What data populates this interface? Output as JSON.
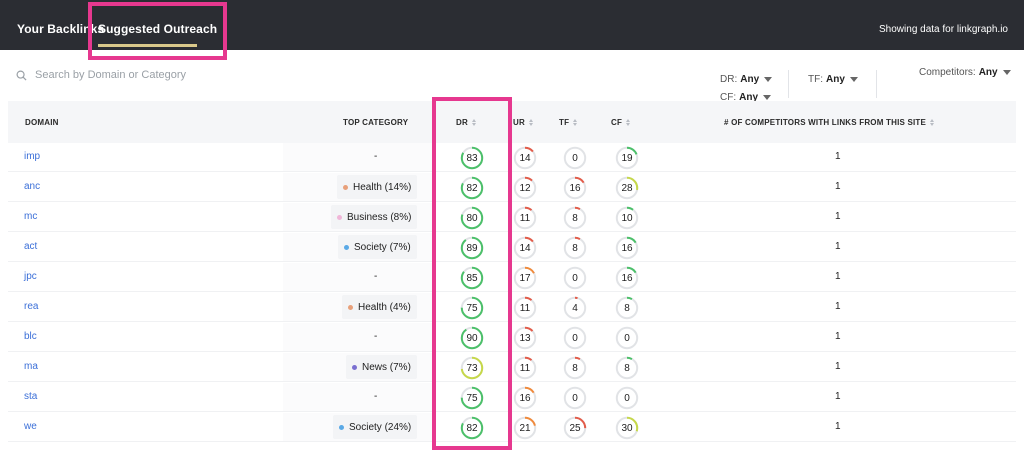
{
  "topbar": {
    "tabs": [
      {
        "label": "Your Backlinks"
      },
      {
        "label": "Suggested Outreach"
      }
    ],
    "status_text": "Showing data for linkgraph.io"
  },
  "search": {
    "placeholder": "Search by Domain or Category"
  },
  "filters": {
    "dr_label": "DR:",
    "dr_value": "Any",
    "cf_label": "CF:",
    "cf_value": "Any",
    "tf_label": "TF:",
    "tf_value": "Any",
    "competitors_label": "Competitors:",
    "competitors_value": "Any"
  },
  "table": {
    "headers": {
      "domain": "DOMAIN",
      "category": "TOP CATEGORY",
      "dr": "DR",
      "ur": "UR",
      "tf": "TF",
      "cf": "CF",
      "competitors": "# OF COMPETITORS WITH LINKS FROM THIS SITE"
    },
    "rows": [
      {
        "domain": "imp",
        "category": "-",
        "cat_color": "",
        "dr": 83,
        "ur": 14,
        "tf": 0,
        "cf": 19,
        "competitors": "1"
      },
      {
        "domain": "anc",
        "category": "Health (14%)",
        "cat_color": "#e8a07a",
        "dr": 82,
        "ur": 12,
        "tf": 16,
        "cf": 28,
        "competitors": "1"
      },
      {
        "domain": "mc",
        "category": "Business (8%)",
        "cat_color": "#f0b6d8",
        "dr": 80,
        "ur": 11,
        "tf": 8,
        "cf": 10,
        "competitors": "1"
      },
      {
        "domain": "act",
        "category": "Society (7%)",
        "cat_color": "#5aa9e6",
        "dr": 89,
        "ur": 14,
        "tf": 8,
        "cf": 16,
        "competitors": "1"
      },
      {
        "domain": "jpc",
        "category": "-",
        "cat_color": "",
        "dr": 85,
        "ur": 17,
        "tf": 0,
        "cf": 16,
        "competitors": "1"
      },
      {
        "domain": "rea",
        "category": "Health (4%)",
        "cat_color": "#e8a07a",
        "dr": 75,
        "ur": 11,
        "tf": 4,
        "cf": 8,
        "competitors": "1"
      },
      {
        "domain": "blc",
        "category": "-",
        "cat_color": "",
        "dr": 90,
        "ur": 13,
        "tf": 0,
        "cf": 0,
        "competitors": "1"
      },
      {
        "domain": "ma",
        "category": "News (7%)",
        "cat_color": "#7a6fd0",
        "dr": 73,
        "ur": 11,
        "tf": 8,
        "cf": 8,
        "competitors": "1"
      },
      {
        "domain": "sta",
        "category": "-",
        "cat_color": "",
        "dr": 75,
        "ur": 16,
        "tf": 0,
        "cf": 0,
        "competitors": "1"
      },
      {
        "domain": "we",
        "category": "Society (24%)",
        "cat_color": "#5aa9e6",
        "dr": 82,
        "ur": 21,
        "tf": 25,
        "cf": 30,
        "competitors": "1"
      }
    ]
  },
  "colors": {
    "highlight": "#e6388f",
    "dr_ring": "#4cc06a",
    "dr_ring_low": "#c6d84a",
    "low_ring": "#e25c4a",
    "mid_ring": "#f08a3c",
    "link": "#3b6fd8"
  }
}
